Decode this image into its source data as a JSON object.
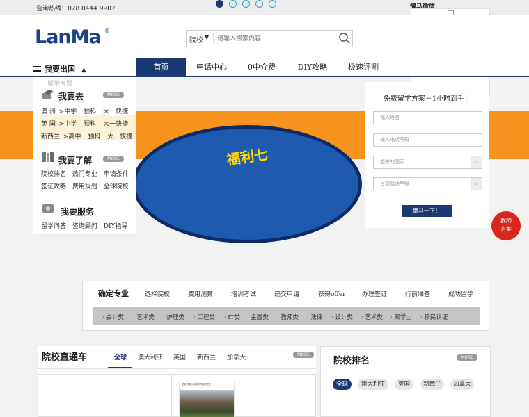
{
  "topbar": {
    "hotline": "咨询热线：028 8444 9907",
    "wechat": "懒马微信"
  },
  "logo": {
    "text": "LanMa",
    "reg": "®"
  },
  "search": {
    "scope": "院校",
    "placeholder": "请输入搜索内容"
  },
  "nav": {
    "menu_label": "我要出国",
    "items": [
      "首页",
      "申请中心",
      "0中介费",
      "DIY攻略",
      "极速评测"
    ]
  },
  "mega": {
    "faint": "留学专题",
    "more": "MORE",
    "go": {
      "title": "我要去",
      "rows": [
        [
          "澳 洲",
          ">中学",
          "预科",
          "大一快捷"
        ],
        [
          "英 国",
          ">中学",
          "预科",
          "大一快捷"
        ],
        [
          "新西兰",
          ">高中",
          "预科",
          "大一快捷"
        ]
      ]
    },
    "learn": {
      "title": "我要了解",
      "rows": [
        [
          "院校排名",
          "热门专业",
          "申请条件"
        ],
        [
          "签证攻略",
          "费用规划",
          "全球院校"
        ]
      ]
    },
    "service": {
      "title": "我要服务",
      "rows": [
        [
          "留学问答",
          "咨询顾问",
          "DIY指导"
        ]
      ]
    }
  },
  "banner": {
    "text": "福利七"
  },
  "form": {
    "title": "免费留学方案－1小时到手！",
    "name_placeholder": "输入姓名",
    "phone_placeholder": "输入电话号码",
    "country_placeholder": "想去的国家",
    "grade_placeholder": "目前就读年级",
    "submit": "懒马一下！"
  },
  "consult": {
    "line1": "我的",
    "line2": "方案"
  },
  "process": {
    "steps": [
      "确定专业",
      "选择院校",
      "费用测算",
      "培训考试",
      "递交申请",
      "获得offer",
      "办理签证",
      "行前准备",
      "成功留学"
    ],
    "categories": [
      "会计类",
      "艺术类",
      "护理类",
      "工程类",
      "IT类",
      "金融类",
      "教师类",
      "法律",
      "设计类",
      "艺术类",
      "双学士",
      "移民认证"
    ]
  },
  "schools": {
    "title": "院校直通车",
    "tabs": [
      "全球",
      "澳大利亚",
      "英国",
      "新西兰",
      "加拿大"
    ],
    "more": "MORE",
    "card_caption": "悉尼科技大学商学院研究生"
  },
  "ranking": {
    "title": "院校排名",
    "more": "MORE",
    "pills": [
      "全球",
      "澳大利亚",
      "英国",
      "新西兰",
      "加拿大"
    ]
  },
  "colors": {
    "brand": "#1b3a73",
    "banner": "#f7941d",
    "accent_red": "#d7261b"
  }
}
